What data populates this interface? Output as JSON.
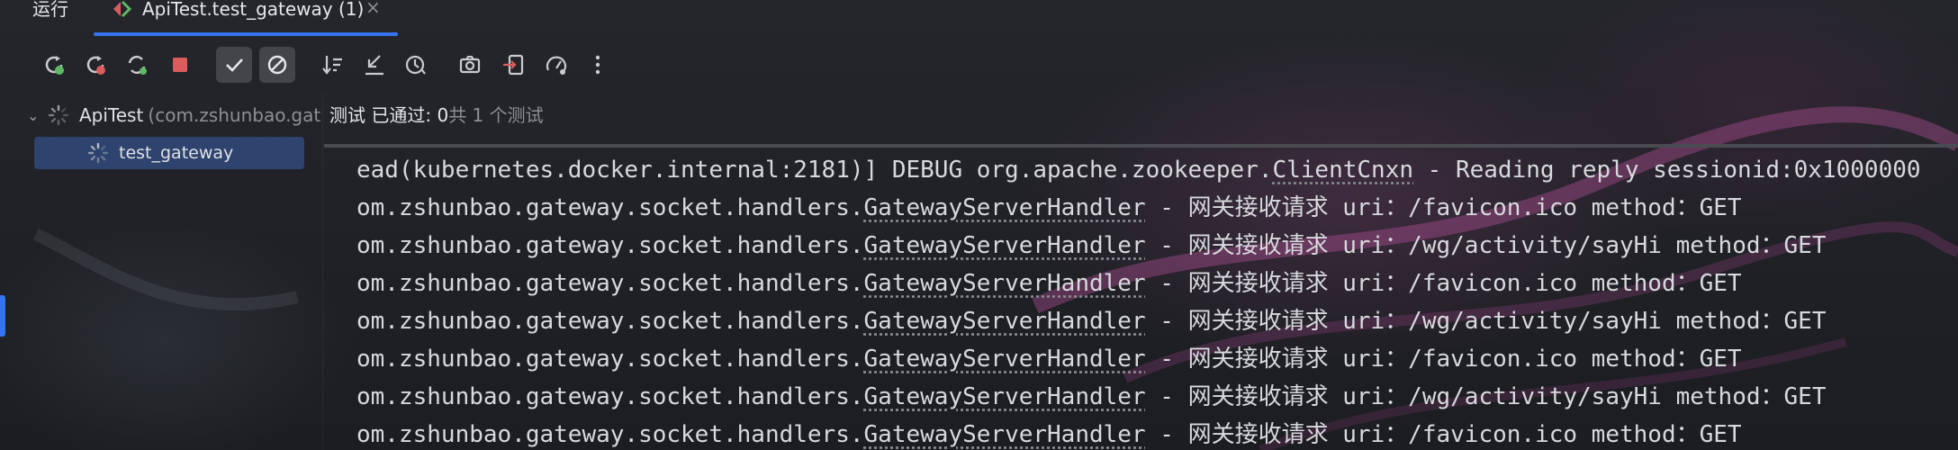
{
  "window": {
    "run_label": "运行",
    "tab_title": "ApiTest.test_gateway (1)",
    "tab_close": "×"
  },
  "toolbar": {
    "buttons": [
      {
        "icon": "rerun-icon"
      },
      {
        "icon": "rerun-failed-icon"
      },
      {
        "icon": "toggle-auto-test-icon"
      },
      {
        "icon": "stop-icon"
      },
      {
        "icon": "show-passed-check-icon",
        "active": true
      },
      {
        "icon": "show-ignored-icon",
        "active": true
      },
      {
        "icon": "sort-alphabetically-icon"
      },
      {
        "icon": "collapse-all-icon"
      },
      {
        "icon": "sort-by-duration-icon"
      },
      {
        "icon": "screenshot-camera-icon"
      },
      {
        "icon": "import-tests-icon"
      },
      {
        "icon": "test-history-gauge-icon"
      },
      {
        "icon": "more-options-icon"
      }
    ]
  },
  "tree": {
    "root_name": "ApiTest",
    "root_package": "(com.zshunbao.gat",
    "child_name": "test_gateway"
  },
  "status": {
    "text": "测试 已通过: 0",
    "count": "共 1 个测试"
  },
  "console": {
    "lines": [
      {
        "prefix": "ead(kubernetes.docker.internal:2181)] DEBUG org.apache.zookeeper.",
        "cls": "ClientCnxn",
        "suffix": " - Reading reply sessionid:0x1000000"
      },
      {
        "prefix": "om.zshunbao.gateway.socket.handlers.",
        "cls": "GatewayServerHandler",
        "suffix": " - 网关接收请求 uri：/favicon.ico method：GET"
      },
      {
        "prefix": "om.zshunbao.gateway.socket.handlers.",
        "cls": "GatewayServerHandler",
        "suffix": " - 网关接收请求 uri：/wg/activity/sayHi method：GET"
      },
      {
        "prefix": "om.zshunbao.gateway.socket.handlers.",
        "cls": "GatewayServerHandler",
        "suffix": " - 网关接收请求 uri：/favicon.ico method：GET"
      },
      {
        "prefix": "om.zshunbao.gateway.socket.handlers.",
        "cls": "GatewayServerHandler",
        "suffix": " - 网关接收请求 uri：/wg/activity/sayHi method：GET"
      },
      {
        "prefix": "om.zshunbao.gateway.socket.handlers.",
        "cls": "GatewayServerHandler",
        "suffix": " - 网关接收请求 uri：/favicon.ico method：GET"
      },
      {
        "prefix": "om.zshunbao.gateway.socket.handlers.",
        "cls": "GatewayServerHandler",
        "suffix": " - 网关接收请求 uri：/wg/activity/sayHi method：GET"
      },
      {
        "prefix": "om.zshunbao.gateway.socket.handlers.",
        "cls": "GatewayServerHandler",
        "suffix": " - 网关接收请求 uri：/favicon.ico method：GET"
      }
    ]
  },
  "colors": {
    "accent": "#3574f0",
    "background": "#1f2024",
    "selection": "#2e436e",
    "stop_red": "#db5c5c",
    "rerun_green": "#5fb865"
  }
}
